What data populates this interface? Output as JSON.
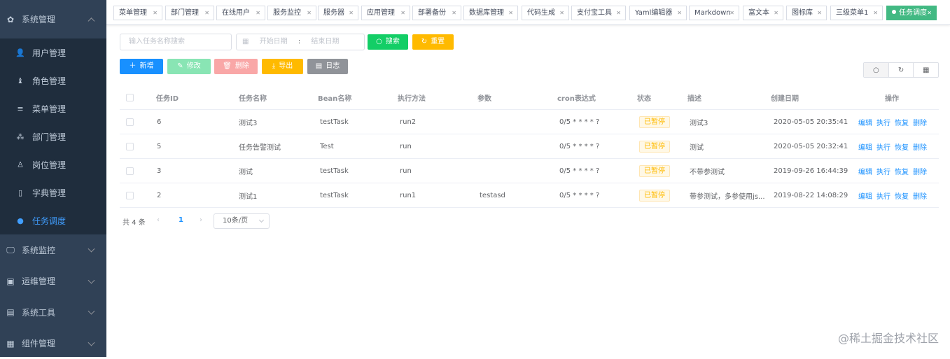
{
  "sidebar": {
    "system": {
      "label": "系统管理",
      "icon": "gear-icon"
    },
    "sub_items": [
      {
        "label": "用户管理",
        "icon": "user-icon"
      },
      {
        "label": "角色管理",
        "icon": "role-icon"
      },
      {
        "label": "菜单管理",
        "icon": "menu-icon"
      },
      {
        "label": "部门管理",
        "icon": "dept-icon"
      },
      {
        "label": "岗位管理",
        "icon": "job-icon"
      },
      {
        "label": "字典管理",
        "icon": "dict-icon"
      },
      {
        "label": "任务调度",
        "icon": "timing-icon",
        "active": true
      }
    ],
    "groups": [
      {
        "label": "系统监控",
        "icon": "monitor-icon"
      },
      {
        "label": "运维管理",
        "icon": "ops-icon"
      },
      {
        "label": "系统工具",
        "icon": "tools-icon"
      },
      {
        "label": "组件管理",
        "icon": "components-icon"
      }
    ]
  },
  "tags": [
    "菜单管理",
    "部门管理",
    "在线用户",
    "服务监控",
    "服务器",
    "应用管理",
    "部署备份",
    "数据库管理",
    "代码生成",
    "支付宝工具",
    "Yaml编辑器",
    "Markdown",
    "富文本",
    "图标库",
    "三级菜单1",
    "任务调度"
  ],
  "search": {
    "name_placeholder": "输入任务名称搜索",
    "start_placeholder": "开始日期",
    "separator": ":",
    "end_placeholder": "结束日期",
    "search_label": "搜索",
    "reset_label": "重置"
  },
  "toolbar": {
    "add_label": "新增",
    "edit_label": "修改",
    "delete_label": "删除",
    "export_label": "导出",
    "log_label": "日志"
  },
  "table": {
    "headers": [
      "任务ID",
      "任务名称",
      "Bean名称",
      "执行方法",
      "参数",
      "cron表达式",
      "状态",
      "描述",
      "创建日期",
      "操作"
    ],
    "rows": [
      {
        "id": "6",
        "name": "测试3",
        "bean": "testTask",
        "method": "run2",
        "params": "",
        "cron": "0/5 * * * * ?",
        "status": "已暂停",
        "desc": "测试3",
        "created": "2020-05-05 20:35:41"
      },
      {
        "id": "5",
        "name": "任务告警测试",
        "bean": "Test",
        "method": "run",
        "params": "",
        "cron": "0/5 * * * * ?",
        "status": "已暂停",
        "desc": "测试",
        "created": "2020-05-05 20:32:41"
      },
      {
        "id": "3",
        "name": "测试",
        "bean": "testTask",
        "method": "run",
        "params": "",
        "cron": "0/5 * * * * ?",
        "status": "已暂停",
        "desc": "不带参测试",
        "created": "2019-09-26 16:44:39"
      },
      {
        "id": "2",
        "name": "测试1",
        "bean": "testTask",
        "method": "run1",
        "params": "testasd",
        "cron": "0/5 * * * * ?",
        "status": "已暂停",
        "desc": "带参测试，多参使用js...",
        "created": "2019-08-22 14:08:29"
      }
    ],
    "ops": [
      "编辑",
      "执行",
      "恢复",
      "删除"
    ]
  },
  "pagination": {
    "total": "共 4 条",
    "current": "1",
    "page_size": "10条/页"
  },
  "watermark": "@稀土掘金技术社区"
}
